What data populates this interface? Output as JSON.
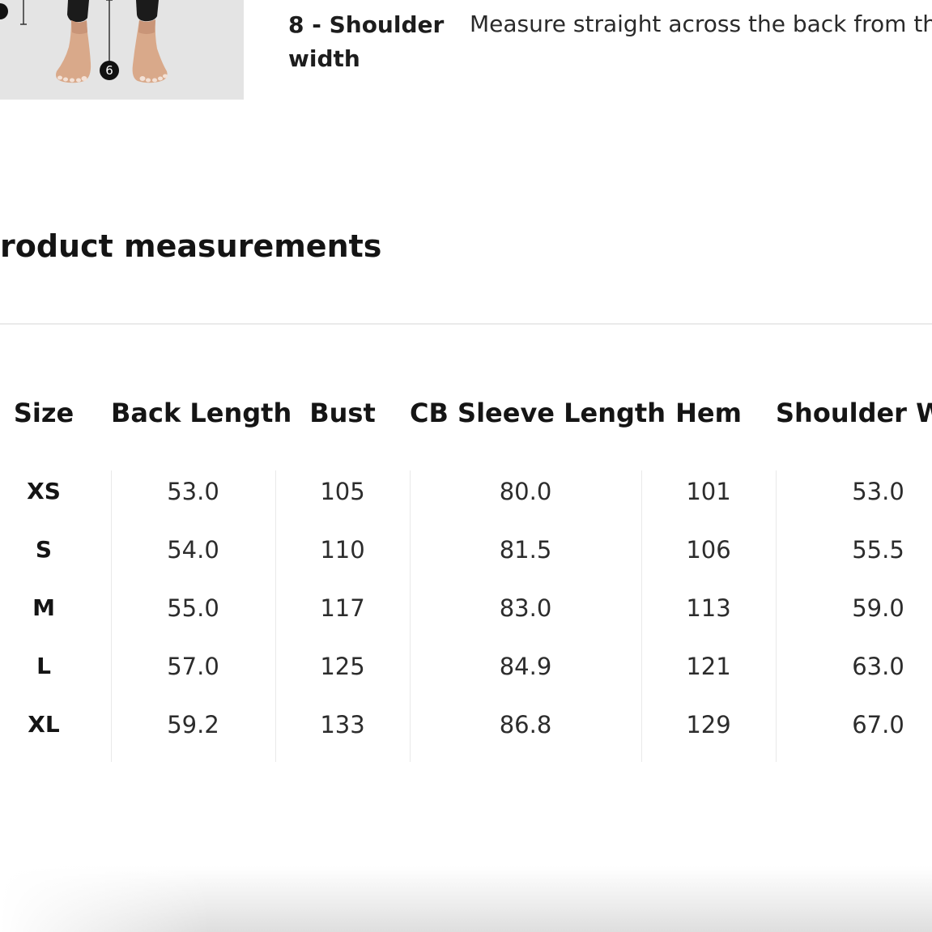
{
  "figure": {
    "marker_label": "6"
  },
  "guide": {
    "term": "8 - Shoulder width",
    "description": "Measure straight across the back from th"
  },
  "section": {
    "title": "roduct measurements"
  },
  "table": {
    "headers": [
      "Size",
      "Back Length",
      "Bust",
      "CB Sleeve Length",
      "Hem",
      "Shoulder Wi"
    ],
    "rows": [
      {
        "size": "XS",
        "values": [
          "53.0",
          "105",
          "80.0",
          "101",
          "53.0"
        ]
      },
      {
        "size": "S",
        "values": [
          "54.0",
          "110",
          "81.5",
          "106",
          "55.5"
        ]
      },
      {
        "size": "M",
        "values": [
          "55.0",
          "117",
          "83.0",
          "113",
          "59.0"
        ]
      },
      {
        "size": "L",
        "values": [
          "57.0",
          "125",
          "84.9",
          "121",
          "63.0"
        ]
      },
      {
        "size": "XL",
        "values": [
          "59.2",
          "133",
          "86.8",
          "129",
          "67.0"
        ]
      }
    ]
  },
  "colors": {
    "text": "#1d1d1d",
    "divider": "#eaeaea",
    "figure_bg": "#e6e6e6"
  }
}
